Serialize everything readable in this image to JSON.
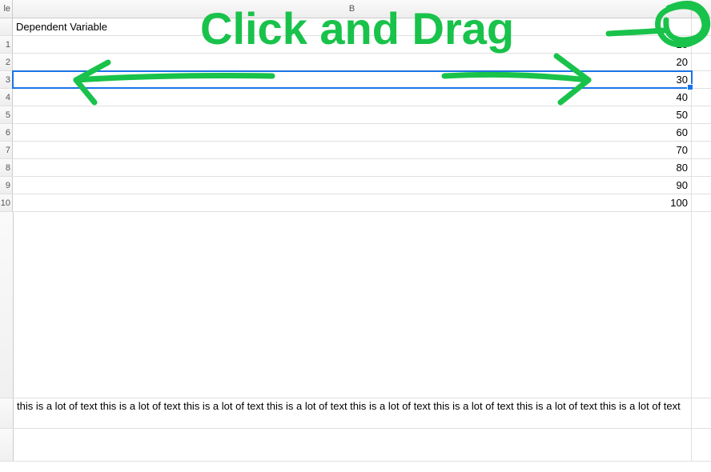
{
  "annotation": {
    "text": "Click and Drag",
    "color": "#19c24a"
  },
  "columns": {
    "partial_label": "le",
    "b_label": "B"
  },
  "header_row": {
    "b_text": "Dependent Variable"
  },
  "rows": [
    {
      "a": "1",
      "b": "10"
    },
    {
      "a": "2",
      "b": "20"
    },
    {
      "a": "3",
      "b": "30"
    },
    {
      "a": "4",
      "b": "40"
    },
    {
      "a": "5",
      "b": "50"
    },
    {
      "a": "6",
      "b": "60"
    },
    {
      "a": "7",
      "b": "70"
    },
    {
      "a": "8",
      "b": "80"
    },
    {
      "a": "9",
      "b": "90"
    },
    {
      "a": "10",
      "b": "100"
    }
  ],
  "selected_row_index": 2,
  "long_text": "this is a lot of text       this is a lot of text       this is a lot of text       this is a lot of text       this is a lot of text       this is a lot of text       this is a lot of text       this is a lot of text"
}
